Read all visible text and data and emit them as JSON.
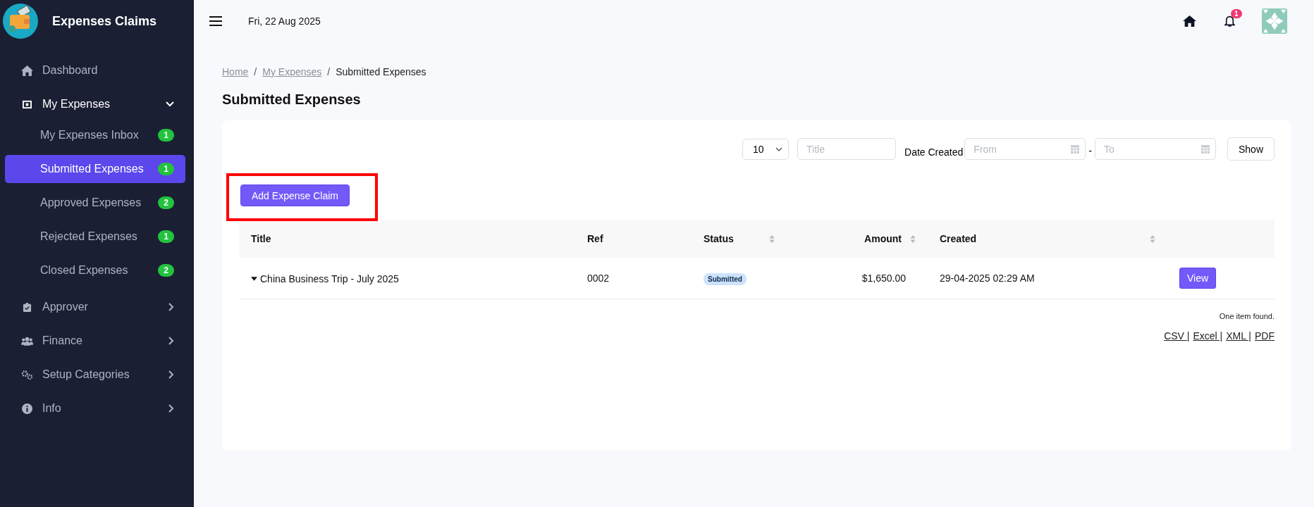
{
  "app": {
    "title": "Expenses Claims"
  },
  "sidebar": {
    "items": [
      {
        "label": "Dashboard",
        "kind": "link",
        "selected": false
      },
      {
        "label": "My Expenses",
        "kind": "group",
        "expanded": true,
        "selected": true,
        "children": [
          {
            "label": "My Expenses Inbox",
            "badge": "1",
            "selected": false
          },
          {
            "label": "Submitted Expenses",
            "badge": "1",
            "selected": true
          },
          {
            "label": "Approved Expenses",
            "badge": "2",
            "selected": false
          },
          {
            "label": "Rejected Expenses",
            "badge": "1",
            "selected": false
          },
          {
            "label": "Closed Expenses",
            "badge": "2",
            "selected": false
          }
        ]
      },
      {
        "label": "Approver",
        "kind": "group",
        "expanded": false,
        "selected": false
      },
      {
        "label": "Finance",
        "kind": "group",
        "expanded": false,
        "selected": false
      },
      {
        "label": "Setup Categories",
        "kind": "group",
        "expanded": false,
        "selected": false
      },
      {
        "label": "Info",
        "kind": "group",
        "expanded": false,
        "selected": false
      }
    ]
  },
  "topbar": {
    "date": "Fri, 22 Aug 2025",
    "notifications": "1"
  },
  "breadcrumb": [
    {
      "label": "Home",
      "link": true,
      "separator": "/"
    },
    {
      "label": "My Expenses",
      "link": true,
      "separator": "/"
    },
    {
      "label": "Submitted Expenses",
      "link": false
    }
  ],
  "page_title": "Submitted Expenses",
  "filters": {
    "page_size": "10",
    "title_placeholder": "Title",
    "date_label": "Date Created",
    "from_placeholder": "From",
    "range_separator": "-",
    "to_placeholder": "To",
    "show_button": "Show"
  },
  "add_button": {
    "label": "Add Expense Claim",
    "highlighted": true
  },
  "table": {
    "columns": [
      {
        "label": "Title",
        "sortable": false
      },
      {
        "label": "Ref",
        "sortable": false
      },
      {
        "label": "Status",
        "sortable": true
      },
      {
        "label": "Amount",
        "sortable": true
      },
      {
        "label": "Created",
        "sortable": true
      }
    ],
    "rows": [
      {
        "expanded": false,
        "title": "China Business Trip - July 2025",
        "ref": "0002",
        "status": "Submitted",
        "amount": "$1,650.00",
        "created": "29-04-2025 02:29 AM",
        "action": "View"
      }
    ]
  },
  "summary": "One item found.",
  "exports": [
    {
      "label": "CSV |"
    },
    {
      "label": "Excel |"
    },
    {
      "label": "XML |"
    },
    {
      "label": "PDF"
    }
  ]
}
